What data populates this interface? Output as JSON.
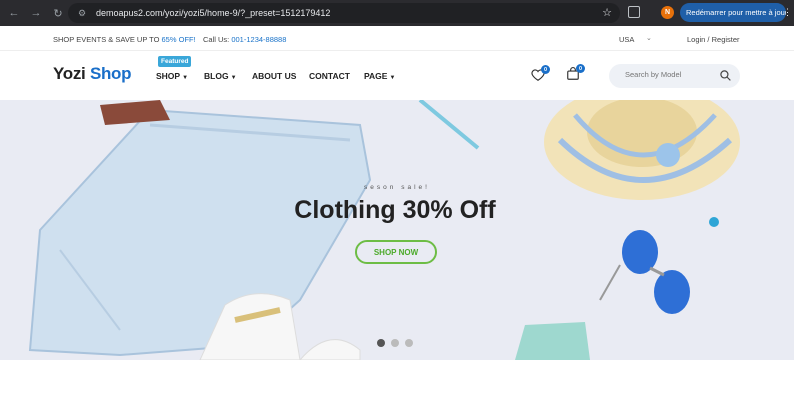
{
  "browser": {
    "url": "demoapus2.com/yozi/yozi5/home-9/?_preset=1512179412",
    "profile_initial": "N",
    "relaunch_label": "Redémarrer pour mettre à jour"
  },
  "topbar": {
    "promo_text": "SHOP EVENTS & SAVE UP TO ",
    "promo_accent": "65% OFF!",
    "phone_label": "Call Us: ",
    "phone_number": "001-1234-88888",
    "currency": "USA",
    "login_label": "Login / Register"
  },
  "header": {
    "logo_part1": "Yozi",
    "logo_part2": "Shop",
    "featured_badge": "Featured",
    "nav": [
      {
        "label": "SHOP",
        "has_caret": true
      },
      {
        "label": "BLOG",
        "has_caret": true
      },
      {
        "label": "ABOUT US",
        "has_caret": false
      },
      {
        "label": "CONTACT",
        "has_caret": false
      },
      {
        "label": "PAGE",
        "has_caret": true
      }
    ],
    "wishlist_count": "0",
    "cart_count": "0",
    "search_placeholder": "Search by Model"
  },
  "hero": {
    "subtitle": "seson sale!",
    "title": "Clothing 30% Off",
    "cta_label": "SHOP NOW",
    "slide_count": 3,
    "active_slide": 1
  },
  "colors": {
    "brand_blue": "#1a6fc9",
    "cta_green": "#6dbd45",
    "hero_bg": "#e9ebf3"
  }
}
